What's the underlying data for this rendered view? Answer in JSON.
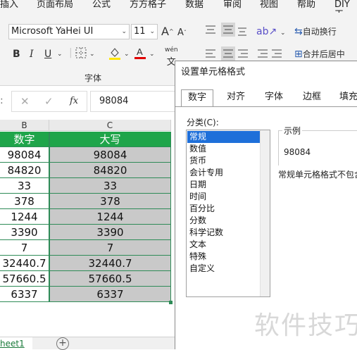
{
  "menu": [
    "插入",
    "页面布局",
    "公式",
    "方方格子",
    "数据",
    "审阅",
    "视图",
    "帮助",
    "DIY工"
  ],
  "ribbon": {
    "font_name": "Microsoft YaHei UI",
    "font_size": "11",
    "grow_font": "A",
    "shrink_font": "A",
    "bold": "B",
    "italic": "I",
    "underline": "U",
    "phonetic": "wén",
    "font_group_label": "字体",
    "wrap_text": "自动换行",
    "merge_center": "合并后居中"
  },
  "formula_bar": {
    "cancel": "✕",
    "enter": "✓",
    "fx": "fx",
    "value": "98084"
  },
  "columns": {
    "b": "B",
    "c": "C"
  },
  "table": {
    "header_b": "数字",
    "header_c": "大写",
    "rows": [
      [
        "98084",
        "98084"
      ],
      [
        "84820",
        "84820"
      ],
      [
        "33",
        "33"
      ],
      [
        "378",
        "378"
      ],
      [
        "1244",
        "1244"
      ],
      [
        "3390",
        "3390"
      ],
      [
        "7",
        "7"
      ],
      [
        "32440.7",
        "32440.7"
      ],
      [
        "57660.5",
        "57660.5"
      ],
      [
        "6337",
        "6337"
      ]
    ]
  },
  "sheet_tab": "heet1",
  "add_sheet": "+",
  "dialog": {
    "title": "设置单元格格式",
    "tabs": [
      "数字",
      "对齐",
      "字体",
      "边框",
      "填充"
    ],
    "category_label": "分类(C):",
    "categories": [
      "常规",
      "数值",
      "货币",
      "会计专用",
      "日期",
      "时间",
      "百分比",
      "分数",
      "科学记数",
      "文本",
      "特殊",
      "自定义"
    ],
    "sample_label": "示例",
    "sample_value": "98084",
    "description": "常规单元格格式不包含"
  },
  "watermark": "软件技巧",
  "colors": {
    "header_green": "#1fa54a",
    "selection_gray": "#c9c9c9",
    "border_green": "#2e8b57",
    "list_select": "#1e6fd9"
  }
}
